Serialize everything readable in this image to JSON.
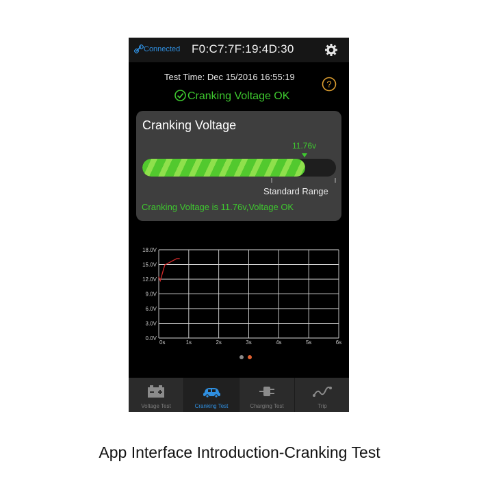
{
  "header": {
    "connection_label": "Connected",
    "device_id": "F0:C7:7F:19:4D:30",
    "icons": {
      "link": "link-icon",
      "settings": "gear-icon"
    }
  },
  "test": {
    "time_text": "Test Time:  Dec 15/2016 16:55:19",
    "status_text": "Cranking Voltage OK",
    "help_icon": "question-icon"
  },
  "card": {
    "title": "Cranking Voltage",
    "value_label": "11.76v",
    "fill_fraction": 0.84,
    "range_label": "Standard Range",
    "message": "Cranking Voltage is 11.76v,Voltage OK"
  },
  "chart_data": {
    "type": "line",
    "title": "",
    "xlabel": "",
    "ylabel": "",
    "x_ticks": [
      "0s",
      "1s",
      "2s",
      "3s",
      "4s",
      "5s",
      "6s"
    ],
    "y_ticks": [
      "0.0V",
      "3.0V",
      "6.0V",
      "9.0V",
      "12.0V",
      "15.0V",
      "18.0V"
    ],
    "xlim": [
      0,
      6
    ],
    "ylim": [
      0,
      18
    ],
    "grid": true,
    "series": [
      {
        "x": [
          0,
          0.05,
          0.2,
          0.6,
          0.7
        ],
        "y": [
          12.5,
          11.7,
          14.9,
          16.2,
          16.2
        ],
        "color": "#d42a2a"
      }
    ]
  },
  "pager": {
    "page_count": 2,
    "active_index": 1,
    "active_color": "#e06030",
    "inactive_color": "#8a8a8a"
  },
  "tabs": [
    {
      "label": "Voltage Test",
      "icon": "battery-icon",
      "active": false
    },
    {
      "label": "Cranking Test",
      "icon": "car-icon",
      "active": true
    },
    {
      "label": "Charging Test",
      "icon": "plug-icon",
      "active": false
    },
    {
      "label": "Trip",
      "icon": "trip-line-icon",
      "active": false
    }
  ],
  "caption": "App Interface Introduction-Cranking Test",
  "colors": {
    "accent_blue": "#2f8fe0",
    "ok_green": "#3ec92f",
    "line_red": "#d42a2a"
  }
}
